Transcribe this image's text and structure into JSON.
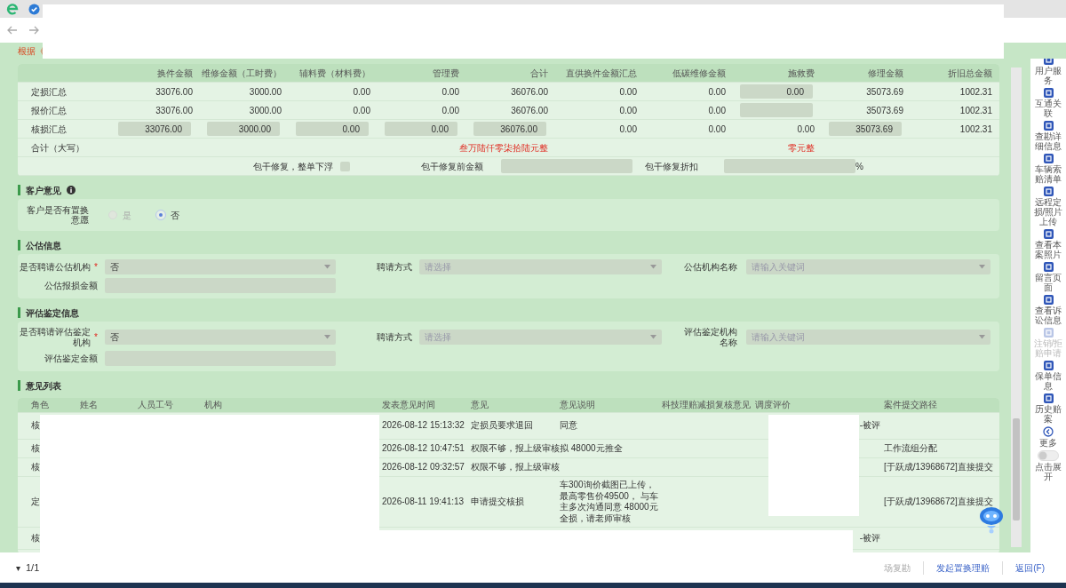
{
  "page_title": "根据《",
  "summary_table": {
    "columns": [
      "换件金额",
      "维修金额（工时费）",
      "辅料费（材料费）",
      "管理费",
      "合计",
      "直供换件金额汇总",
      "低碳维修金额",
      "施救费",
      "修理金额",
      "折旧总金额"
    ],
    "rows": [
      {
        "label": "定损汇总",
        "cells": [
          {
            "kind": "text",
            "value": "33076.00"
          },
          {
            "kind": "text",
            "value": "3000.00"
          },
          {
            "kind": "text",
            "value": "0.00"
          },
          {
            "kind": "text",
            "value": "0.00"
          },
          {
            "kind": "text",
            "value": "36076.00"
          },
          {
            "kind": "text",
            "value": "0.00"
          },
          {
            "kind": "text",
            "value": "0.00"
          },
          {
            "kind": "input",
            "value": "0.00"
          },
          {
            "kind": "text",
            "value": "35073.69"
          },
          {
            "kind": "text",
            "value": "1002.31"
          }
        ]
      },
      {
        "label": "报价汇总",
        "cells": [
          {
            "kind": "text",
            "value": "33076.00"
          },
          {
            "kind": "text",
            "value": "3000.00"
          },
          {
            "kind": "text",
            "value": "0.00"
          },
          {
            "kind": "text",
            "value": "0.00"
          },
          {
            "kind": "text",
            "value": "36076.00"
          },
          {
            "kind": "text",
            "value": "0.00"
          },
          {
            "kind": "text",
            "value": "0.00"
          },
          {
            "kind": "input"
          },
          {
            "kind": "text",
            "value": "35073.69"
          },
          {
            "kind": "text",
            "value": "1002.31"
          }
        ]
      },
      {
        "label": "核损汇总",
        "cells": [
          {
            "kind": "input",
            "value": "33076.00"
          },
          {
            "kind": "input",
            "value": "3000.00"
          },
          {
            "kind": "input",
            "value": "0.00"
          },
          {
            "kind": "input",
            "value": "0.00"
          },
          {
            "kind": "input",
            "value": "36076.00"
          },
          {
            "kind": "text",
            "value": "0.00"
          },
          {
            "kind": "text",
            "value": "0.00"
          },
          {
            "kind": "text",
            "value": "0.00"
          },
          {
            "kind": "input",
            "value": "35073.69"
          },
          {
            "kind": "text",
            "value": "1002.31"
          }
        ]
      }
    ],
    "total_row": {
      "label": "合计（大写）",
      "amount_in_words": "叁万陆仟零柒拾陆元整",
      "rescue_in_words": "零元整"
    },
    "package_row": {
      "checkbox_label": "包干修复，整单下浮",
      "checked": false,
      "amount_label": "包干修复前金额",
      "discount_label": "包干修复折扣",
      "unit": "%"
    }
  },
  "customer_opinion": {
    "title": "客户意见",
    "question": "客户是否有置换意愿",
    "options": [
      {
        "label": "是",
        "selected": false,
        "disabled": true
      },
      {
        "label": "否",
        "selected": true,
        "disabled": false
      }
    ]
  },
  "appraisal_sections": [
    {
      "title": "公估信息",
      "fields": [
        {
          "label": "是否聘请公估机构",
          "required_mark": "*",
          "kind": "select",
          "value": "否"
        },
        {
          "label": "聘请方式",
          "kind": "select",
          "placeholder": "请选择"
        },
        {
          "label": "公估机构名称",
          "kind": "select",
          "placeholder": "请输入关键词"
        },
        {
          "label": "公估报损金额",
          "kind": "input"
        }
      ]
    },
    {
      "title": "评估鉴定信息",
      "fields": [
        {
          "label": "是否聘请评估鉴定机构",
          "required_mark": "*",
          "kind": "select",
          "value": "否"
        },
        {
          "label": "聘请方式",
          "kind": "select",
          "placeholder": "请选择"
        },
        {
          "label": "评估鉴定机构名称",
          "kind": "select",
          "placeholder": "请输入关键词"
        },
        {
          "label": "评估鉴定金额",
          "kind": "input"
        }
      ]
    }
  ],
  "opinion_list": {
    "title": "意见列表",
    "columns": [
      "角色",
      "姓名",
      "人员工号",
      "机构",
      "发表意见时间",
      "意见",
      "意见说明",
      "科技理赔减损复核意见",
      "调度评价",
      "案件提交路径"
    ],
    "rows": [
      {
        "role": "核",
        "time": "2026-08-12 15:13:32",
        "opinion": "定损员要求退回",
        "explanation": "同意",
        "dispatch_rating": "-被评"
      },
      {
        "role": "核",
        "time": "2026-08-12 10:47:51",
        "opinion": "权限不够，报上级审核",
        "explanation": "拟 48000元推全",
        "submit_path": "工作流组分配"
      },
      {
        "role": "核",
        "time": "2026-08-12 09:32:57",
        "opinion": "权限不够，报上级审核",
        "submit_path": "[于跃成/13968672]直接提交"
      },
      {
        "role": "定",
        "time": "2026-08-11 19:41:13",
        "opinion": "申请提交核损",
        "explanation": "车300询价截图已上传，最高零售价49500， 与车主多次沟通同意 48000元全损，请老师审核",
        "submit_path": "[于跃成/13968672]直接提交"
      },
      {
        "role": "核",
        "dispatch_rating": "-被评"
      }
    ]
  },
  "pager": {
    "expander": "▾",
    "page": "1/1"
  },
  "actions": [
    {
      "label": "场复勘",
      "disabled": true
    },
    {
      "label": "发起置换理赔",
      "disabled": false
    },
    {
      "label": "返回(F)",
      "disabled": false
    }
  ],
  "sidebar": [
    {
      "kind": "item",
      "label": "用户服务",
      "disabled": false
    },
    {
      "kind": "item",
      "label": "互通关联",
      "disabled": false
    },
    {
      "kind": "item",
      "label": "查勘详细信息",
      "disabled": false
    },
    {
      "kind": "item",
      "label": "车辆索赔清单",
      "disabled": false
    },
    {
      "kind": "item",
      "label": "远程定损/照片上传",
      "disabled": false
    },
    {
      "kind": "item",
      "label": "查看本案照片",
      "disabled": false
    },
    {
      "kind": "item",
      "label": "留言页面",
      "disabled": false
    },
    {
      "kind": "item",
      "label": "查看诉讼信息",
      "disabled": false
    },
    {
      "kind": "item",
      "label": "注销/拒赔申请",
      "disabled": true
    },
    {
      "kind": "item",
      "label": "保单信息",
      "disabled": false
    },
    {
      "kind": "item",
      "label": "历史赔案",
      "disabled": false
    },
    {
      "kind": "more",
      "label": "更多",
      "disabled": false
    },
    {
      "kind": "toggle",
      "label": "点击展开",
      "on": false
    }
  ]
}
